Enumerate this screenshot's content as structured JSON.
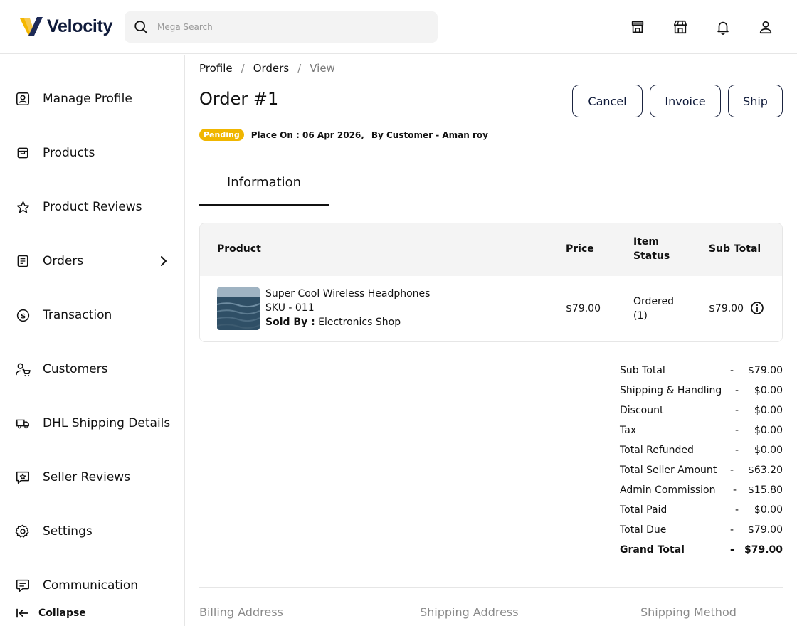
{
  "app": {
    "brand": "Velocity",
    "search_placeholder": "Mega Search"
  },
  "header_icons": [
    "store-icon",
    "shop-icon",
    "bell-icon",
    "user-icon"
  ],
  "sidebar": {
    "items": [
      {
        "label": "Manage Profile",
        "icon": "profile-icon"
      },
      {
        "label": "Products",
        "icon": "box-icon"
      },
      {
        "label": "Product Reviews",
        "icon": "star-icon"
      },
      {
        "label": "Orders",
        "icon": "document-icon",
        "has_submenu": true
      },
      {
        "label": "Transaction",
        "icon": "dollar-icon"
      },
      {
        "label": "Customers",
        "icon": "customer-cart-icon"
      },
      {
        "label": "DHL Shipping Details",
        "icon": "truck-icon"
      },
      {
        "label": "Seller Reviews",
        "icon": "review-icon"
      },
      {
        "label": "Settings",
        "icon": "gear-icon"
      },
      {
        "label": "Communication",
        "icon": "chat-icon"
      }
    ],
    "collapse_label": "Collapse"
  },
  "breadcrumb": {
    "items": [
      "Profile",
      "Orders"
    ],
    "current": "View"
  },
  "order": {
    "title": "Order #1",
    "status": "Pending",
    "placed_on": "Place On : 06 Apr 2026,",
    "by_customer": "By Customer - Aman roy",
    "status_color": "#f0b600"
  },
  "actions": {
    "cancel": "Cancel",
    "invoice": "Invoice",
    "ship": "Ship"
  },
  "tabs": {
    "information": "Information"
  },
  "table": {
    "headers": {
      "product": "Product",
      "price": "Price",
      "item_status_line1": "Item",
      "item_status_line2": "Status",
      "sub_total": "Sub Total"
    },
    "rows": [
      {
        "name": "Super Cool Wireless Headphones",
        "sku": "SKU - 011",
        "sold_by_label": "Sold By :",
        "sold_by": " Electronics Shop",
        "price": "$79.00",
        "status_line1": "Ordered",
        "status_line2": "(1)",
        "sub_total": "$79.00"
      }
    ]
  },
  "summary": [
    {
      "label": "Sub Total",
      "value": "$79.00"
    },
    {
      "label": "Shipping & Handling",
      "value": "$0.00"
    },
    {
      "label": "Discount",
      "value": "$0.00"
    },
    {
      "label": "Tax",
      "value": "$0.00"
    },
    {
      "label": "Total Refunded",
      "value": "$0.00"
    },
    {
      "label": "Total Seller Amount",
      "value": "$63.20"
    },
    {
      "label": "Admin Commission",
      "value": "$15.80"
    },
    {
      "label": "Total Paid",
      "value": "$0.00"
    },
    {
      "label": "Total Due",
      "value": "$79.00"
    },
    {
      "label": "Grand Total",
      "value": "$79.00",
      "bold": true
    }
  ],
  "summary_separator": "-",
  "sections": {
    "billing": "Billing Address",
    "shipping": "Shipping Address",
    "method": "Shipping Method"
  }
}
